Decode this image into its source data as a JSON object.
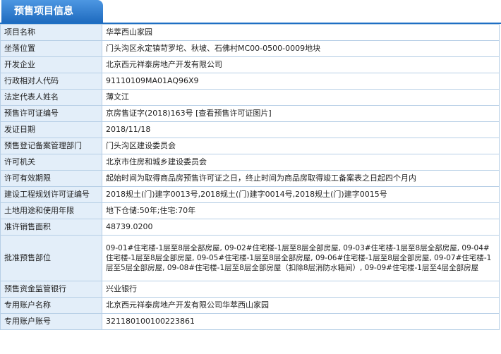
{
  "tab": {
    "title": "预售项目信息"
  },
  "rows": [
    {
      "label": "项目名称",
      "value": "华萃西山家园"
    },
    {
      "label": "坐落位置",
      "value": "门头沟区永定镇苛罗坨、秋坡、石佛村MC00-0500-0009地块"
    },
    {
      "label": "开发企业",
      "value": "北京西元祥泰房地产开发有限公司"
    },
    {
      "label": "行政相对人代码",
      "value": "91110109MA01AQ96X9"
    },
    {
      "label": "法定代表人姓名",
      "value": "薄文江"
    },
    {
      "label": "预售许可证编号",
      "value": "京房售证字(2018)163号",
      "link": "[查看预售许可证图片]"
    },
    {
      "label": "发证日期",
      "value": "2018/11/18"
    },
    {
      "label": "预售登记备案管理部门",
      "value": "门头沟区建设委员会"
    },
    {
      "label": "许可机关",
      "value": "北京市住房和城乡建设委员会"
    },
    {
      "label": "许可有效期限",
      "value": "起始时间为取得商品房预售许可证之日，终止时间为商品房取得竣工备案表之日起四个月内"
    },
    {
      "label": "建设工程规划许可证编号",
      "value": "2018规土(门)建字0013号,2018规土(门)建字0014号,2018规土(门)建字0015号"
    },
    {
      "label": "土地用途和使用年限",
      "value": "地下仓储:50年;住宅:70年"
    },
    {
      "label": "准许销售面积",
      "value": "48739.0200"
    },
    {
      "label": "批准预售部位",
      "value": "09-01#住宅楼-1层至8层全部房屋, 09-02#住宅楼-1层至8层全部房屋, 09-03#住宅楼-1层至8层全部房屋, 09-04#住宅楼-1层至8层全部房屋, 09-05#住宅楼-1层至8层全部房屋, 09-06#住宅楼-1层至8层全部房屋, 09-07#住宅楼-1层至5层全部房屋, 09-08#住宅楼-1层至8层全部房屋（扣除8层消防水箱间）, 09-09#住宅楼-1层至4层全部房屋"
    },
    {
      "label": "预售资金监管银行",
      "value": "兴业银行"
    },
    {
      "label": "专用账户名称",
      "value": "北京西元祥泰房地产开发有限公司华萃西山家园"
    },
    {
      "label": "专用账户账号",
      "value": "321180100100223861"
    }
  ]
}
